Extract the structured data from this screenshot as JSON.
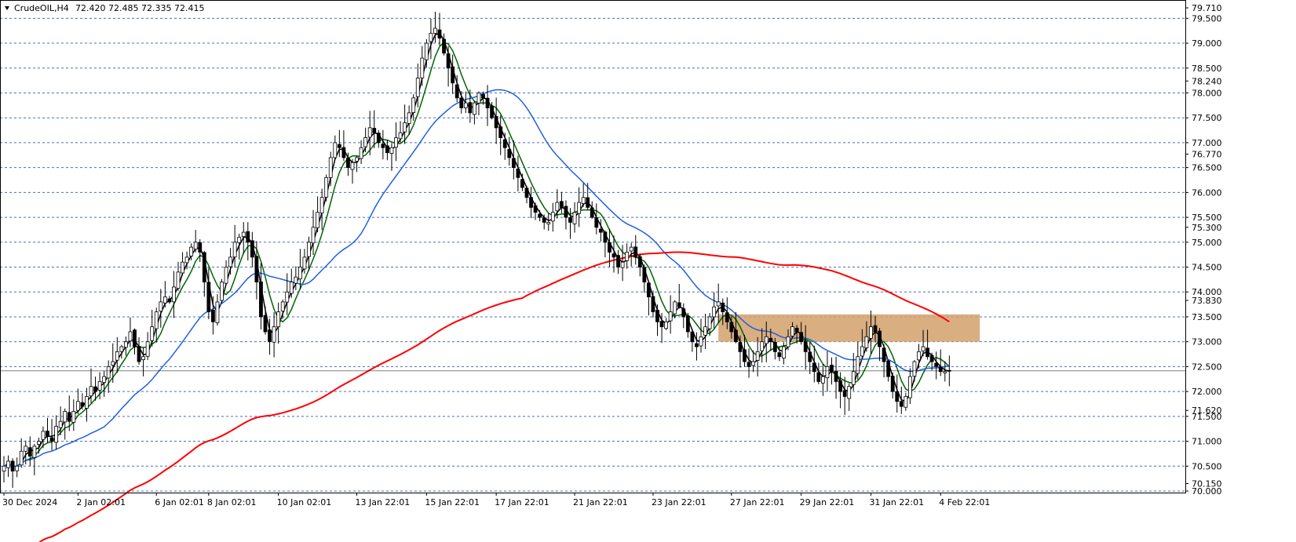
{
  "header": {
    "symbol": "CrudeOIL,H4",
    "ohlc": "72.420 72.485 72.335 72.415"
  },
  "colors": {
    "grid": "#4a6fb8",
    "sma_fast": "#000000",
    "sma_mid": "#006400",
    "sma_slow": "#2060e0",
    "sma_long": "#ff0000",
    "zone_fill": "#d2a06a",
    "bull_candle": "#ffffff",
    "bear_candle": "#000000",
    "bid_line": "#000000"
  },
  "chart_data": {
    "type": "candlestick",
    "ylim": [
      70.0,
      79.71
    ],
    "y_ticks": [
      "79.710",
      "79.500",
      "79.000",
      "78.500",
      "78.240",
      "78.000",
      "77.500",
      "77.000",
      "76.770",
      "76.500",
      "76.000",
      "75.500",
      "75.300",
      "75.000",
      "74.500",
      "74.000",
      "73.830",
      "73.500",
      "73.000",
      "72.500",
      "72.000",
      "71.620",
      "71.500",
      "71.000",
      "70.500",
      "70.150",
      "70.000"
    ],
    "grid_levels": [
      79.5,
      79.0,
      78.5,
      78.0,
      77.5,
      77.0,
      76.5,
      76.0,
      75.5,
      75.0,
      74.5,
      74.0,
      73.5,
      73.0,
      72.5,
      72.0,
      71.5,
      71.0,
      70.5,
      70.0
    ],
    "x_labels": [
      "30 Dec 2024",
      "2 Jan 02:01",
      "6 Jan 02:01",
      "8 Jan 02:01",
      "10 Jan 02:01",
      "13 Jan 22:01",
      "15 Jan 22:01",
      "17 Jan 22:01",
      "21 Jan 22:01",
      "23 Jan 22:01",
      "27 Jan 22:01",
      "29 Jan 22:01",
      "31 Jan 22:01",
      "4 Feb 22:01"
    ],
    "x_label_bar_index": [
      0,
      17,
      35,
      47,
      63,
      81,
      97,
      113,
      131,
      149,
      167,
      183,
      199,
      215
    ],
    "current_price": 72.415,
    "zone": {
      "top": 73.55,
      "bottom": 73.0,
      "start_bar": 164,
      "end_bar": 224
    },
    "closes": [
      70.5,
      70.6,
      70.4,
      70.5,
      70.8,
      70.9,
      70.7,
      70.9,
      71.0,
      71.2,
      71.1,
      71.0,
      71.3,
      71.4,
      71.6,
      71.4,
      71.6,
      71.8,
      71.7,
      71.9,
      72.1,
      72.0,
      72.2,
      72.3,
      72.5,
      72.6,
      72.8,
      72.9,
      73.0,
      73.2,
      72.9,
      72.6,
      72.7,
      73.0,
      73.3,
      73.6,
      73.8,
      73.9,
      73.8,
      74.1,
      74.4,
      74.6,
      74.7,
      74.9,
      75.0,
      74.8,
      74.2,
      73.6,
      73.4,
      73.8,
      74.2,
      74.5,
      74.7,
      75.0,
      75.1,
      75.2,
      75.0,
      74.7,
      74.2,
      73.5,
      73.2,
      73.0,
      73.3,
      73.6,
      73.8,
      74.0,
      74.2,
      74.3,
      74.5,
      74.7,
      75.0,
      75.3,
      75.6,
      75.9,
      76.3,
      76.7,
      77.0,
      76.9,
      76.7,
      76.5,
      76.6,
      76.7,
      76.9,
      77.1,
      77.3,
      77.2,
      77.0,
      76.9,
      76.8,
      76.9,
      77.1,
      77.2,
      77.4,
      77.6,
      77.9,
      78.3,
      78.7,
      79.0,
      79.2,
      79.3,
      79.1,
      78.8,
      78.5,
      78.2,
      77.9,
      77.7,
      77.8,
      77.6,
      77.8,
      78.0,
      77.9,
      77.7,
      77.5,
      77.3,
      77.1,
      76.9,
      76.7,
      76.5,
      76.3,
      76.1,
      75.9,
      75.7,
      75.6,
      75.5,
      75.4,
      75.4,
      75.6,
      75.8,
      75.7,
      75.5,
      75.4,
      75.6,
      75.8,
      75.9,
      75.7,
      75.5,
      75.3,
      75.2,
      75.0,
      74.8,
      74.7,
      74.5,
      74.6,
      74.8,
      74.9,
      74.7,
      74.5,
      74.2,
      73.9,
      73.6,
      73.4,
      73.3,
      73.4,
      73.6,
      73.8,
      73.7,
      73.5,
      73.2,
      73.0,
      72.9,
      73.1,
      73.3,
      73.5,
      73.7,
      73.8,
      73.6,
      73.4,
      73.2,
      73.0,
      72.8,
      72.6,
      72.5,
      72.6,
      72.8,
      73.0,
      73.1,
      73.0,
      72.8,
      72.7,
      72.9,
      73.1,
      73.3,
      73.2,
      73.0,
      72.8,
      72.6,
      72.4,
      72.2,
      72.3,
      72.5,
      72.4,
      72.2,
      72.0,
      71.9,
      72.1,
      72.4,
      72.7,
      72.9,
      73.1,
      73.3,
      73.2,
      72.9,
      72.6,
      72.3,
      72.0,
      71.8,
      71.7,
      71.9,
      72.3,
      72.6,
      72.8,
      72.9,
      72.7,
      72.6,
      72.5,
      72.4,
      72.4,
      72.415
    ],
    "series": [
      {
        "type": "ma",
        "period": 3,
        "color_key": "sma_fast"
      },
      {
        "type": "ma",
        "period": 6,
        "color_key": "sma_mid"
      },
      {
        "type": "ma",
        "period": 24,
        "color_key": "sma_slow"
      },
      {
        "type": "ma",
        "period": 120,
        "color_key": "sma_long"
      }
    ]
  }
}
